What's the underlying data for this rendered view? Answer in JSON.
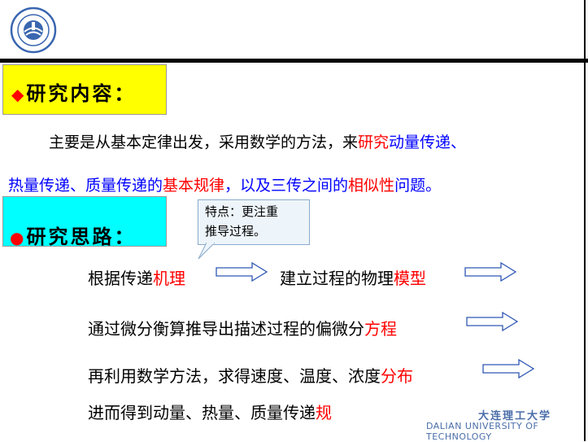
{
  "section1": {
    "bullet": "◆",
    "title": "研究内容：",
    "line1": {
      "p1": "主要是从基本定律出发，采用数学的方法，来",
      "p2": "研究",
      "p3": "动量传递、"
    },
    "line2": {
      "p1": "热量传递、质量传递的",
      "p2": "基本规律",
      "p3": "，以及三传之间的",
      "p4": "相似性",
      "p5": "问题。"
    }
  },
  "section2": {
    "bullet": "●",
    "title": "研究思路："
  },
  "callout": {
    "line1": "特点：更注重",
    "line2": "推导过程。"
  },
  "steps": [
    {
      "a": "根据传递",
      "b": "机理"
    },
    {
      "a": "建立过程的物理",
      "b": "模型"
    },
    {
      "a": "通过微分衡算推导出描述过程的偏微分",
      "b": "方程"
    },
    {
      "a": "再利用数学方法，求得速度、温度、浓度",
      "b": "分布"
    },
    {
      "a": "进而得到动量、热量、质量传递",
      "b": "规"
    }
  ],
  "footer": {
    "cn": "大连理工大学",
    "en": "DALIAN UNIVERSITY OF TECHNOLOGY"
  },
  "colors": {
    "yellow": "#ffff00",
    "cyan": "#00ffff",
    "blue": "#0000ff",
    "red": "#ff0000"
  }
}
